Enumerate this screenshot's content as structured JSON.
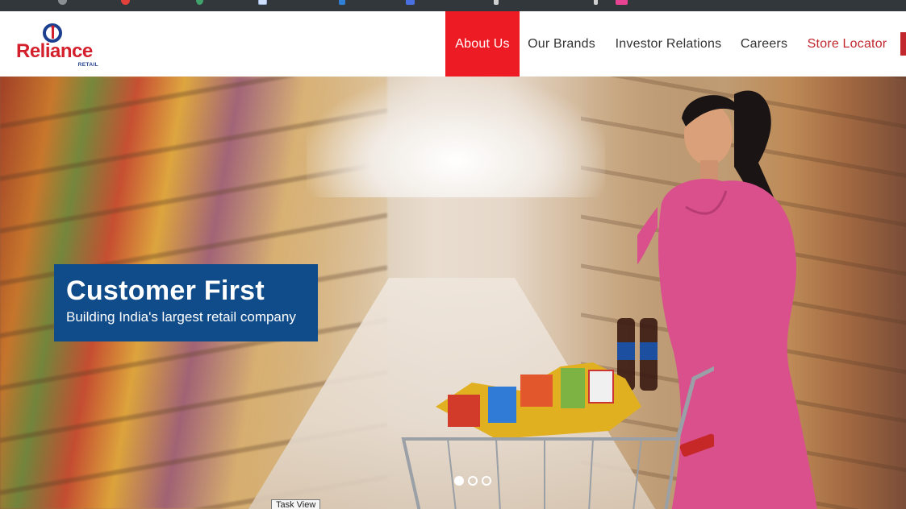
{
  "brand": {
    "name": "Reliance",
    "sub": "RETAIL",
    "primary_color": "#ed1c24",
    "blue_color": "#1d3f8f"
  },
  "nav": {
    "items": [
      {
        "label": "About Us",
        "active": true
      },
      {
        "label": "Our Brands"
      },
      {
        "label": "Investor Relations"
      },
      {
        "label": "Careers"
      },
      {
        "label": "Store Locator"
      }
    ]
  },
  "hero": {
    "title": "Customer First",
    "subtitle": "Building India's largest retail company",
    "caption_color": "#114c8a",
    "slides": 3,
    "active_slide": 1
  },
  "tooltip": {
    "text": "Task View"
  }
}
